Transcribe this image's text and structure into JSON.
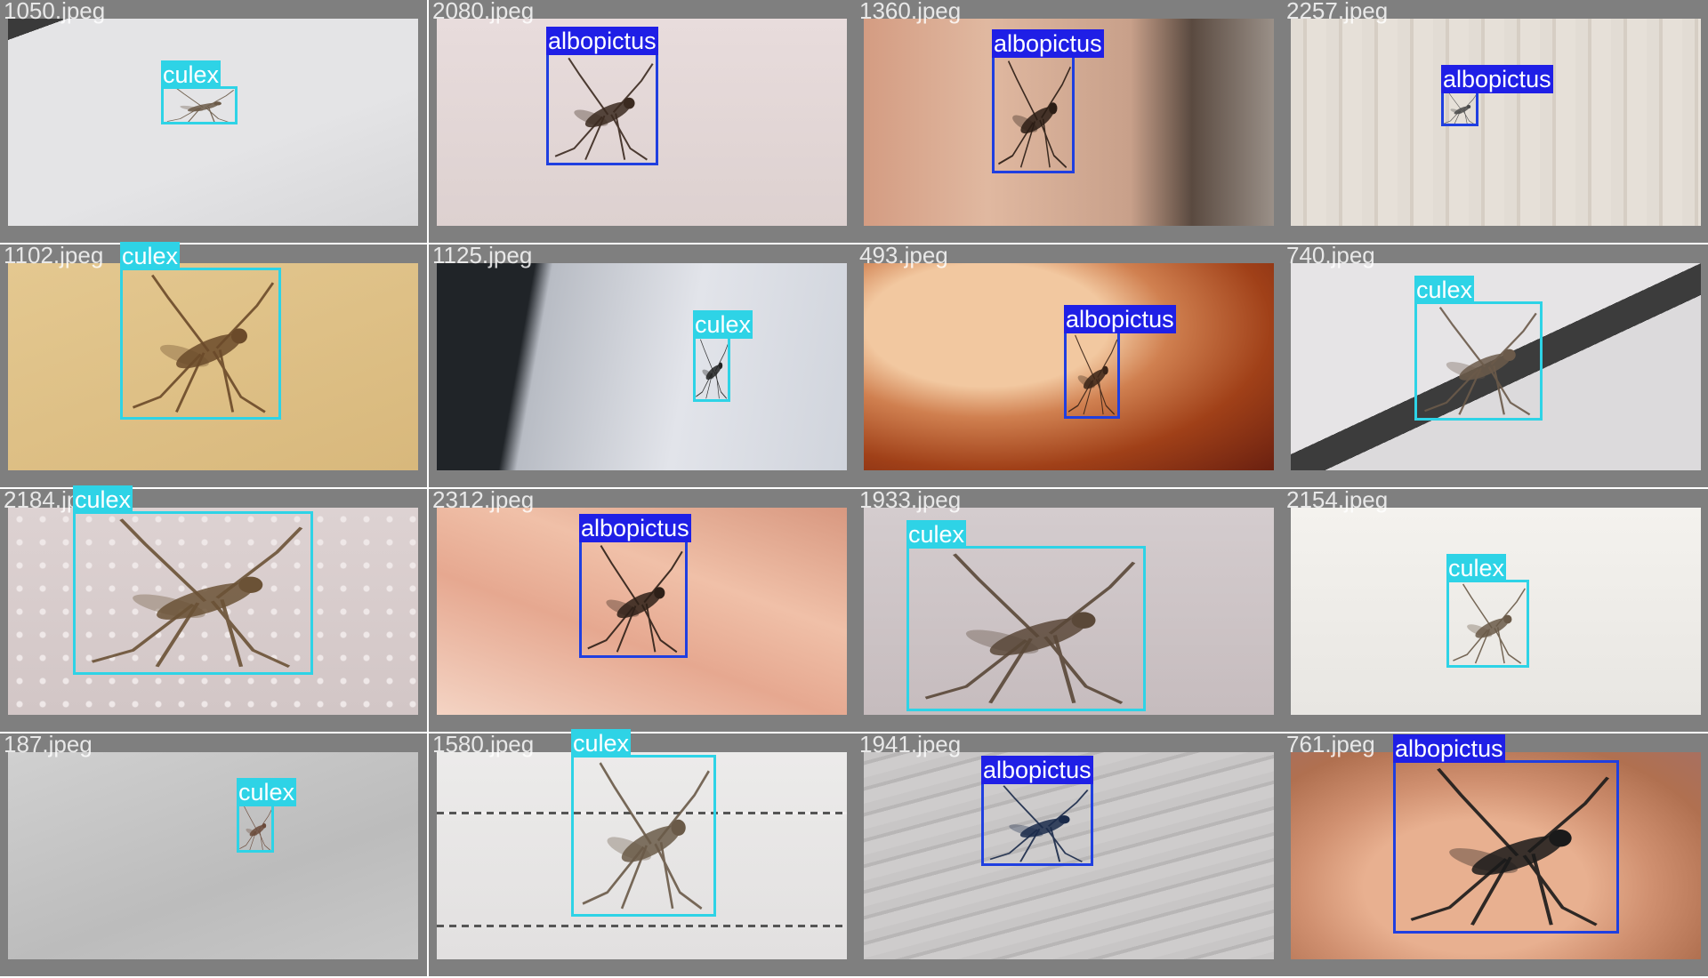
{
  "classes": {
    "culex": {
      "label": "culex",
      "box_color": "#2ed3e6",
      "tag_bg": "#2ed3e6",
      "tag_fg": "#ffffff"
    },
    "albopictus": {
      "label": "albopictus",
      "box_color": "#1f3fe0",
      "tag_bg": "#1f1fe6",
      "tag_fg": "#ffffff"
    }
  },
  "tiles": [
    {
      "filename": "1050.jpeg",
      "background": "light-paper",
      "bug_tone": "#6b5a48",
      "detections": [
        {
          "class": "culex"
        }
      ]
    },
    {
      "filename": "2080.jpeg",
      "background": "pale-pink",
      "bug_tone": "#3b2a20",
      "detections": [
        {
          "class": "albopictus"
        }
      ]
    },
    {
      "filename": "1360.jpeg",
      "background": "fingernail",
      "bug_tone": "#2a1c14",
      "detections": [
        {
          "class": "albopictus"
        }
      ]
    },
    {
      "filename": "2257.jpeg",
      "background": "wood-grain",
      "bug_tone": "#4a4a4a",
      "detections": [
        {
          "class": "albopictus"
        }
      ]
    },
    {
      "filename": "1102.jpeg",
      "background": "tan-surface",
      "bug_tone": "#6b4a2a",
      "detections": [
        {
          "class": "culex"
        }
      ]
    },
    {
      "filename": "1125.jpeg",
      "background": "grey-white-dark",
      "bug_tone": "#222222",
      "detections": [
        {
          "class": "culex"
        }
      ]
    },
    {
      "filename": "493.jpeg",
      "background": "finger-orange",
      "bug_tone": "#3a2418",
      "detections": [
        {
          "class": "albopictus"
        }
      ]
    },
    {
      "filename": "740.jpeg",
      "background": "grey-paper-stripe",
      "bug_tone": "#6b5a4a",
      "detections": [
        {
          "class": "culex"
        }
      ]
    },
    {
      "filename": "2184.jpeg",
      "background": "pink-dotted",
      "bug_tone": "#6b5236",
      "detections": [
        {
          "class": "culex"
        }
      ]
    },
    {
      "filename": "2312.jpeg",
      "background": "fingers-pink",
      "bug_tone": "#2e2018",
      "detections": [
        {
          "class": "albopictus"
        }
      ]
    },
    {
      "filename": "1933.jpeg",
      "background": "grey-pink",
      "bug_tone": "#5a4838",
      "detections": [
        {
          "class": "culex"
        }
      ]
    },
    {
      "filename": "2154.jpeg",
      "background": "off-white",
      "bug_tone": "#6a5a48",
      "detections": [
        {
          "class": "culex"
        }
      ]
    },
    {
      "filename": "187.jpeg",
      "background": "cloth-grey",
      "bug_tone": "#6a4a3a",
      "detections": [
        {
          "class": "culex"
        }
      ]
    },
    {
      "filename": "1580.jpeg",
      "background": "paper-dashed",
      "bug_tone": "#6a5a48",
      "detections": [
        {
          "class": "culex"
        }
      ]
    },
    {
      "filename": "1941.jpeg",
      "background": "grey-wood",
      "bug_tone": "#1a2a4a",
      "detections": [
        {
          "class": "albopictus"
        }
      ]
    },
    {
      "filename": "761.jpeg",
      "background": "finger-closeup",
      "bug_tone": "#1a1a1a",
      "detections": [
        {
          "class": "albopictus"
        }
      ]
    }
  ]
}
